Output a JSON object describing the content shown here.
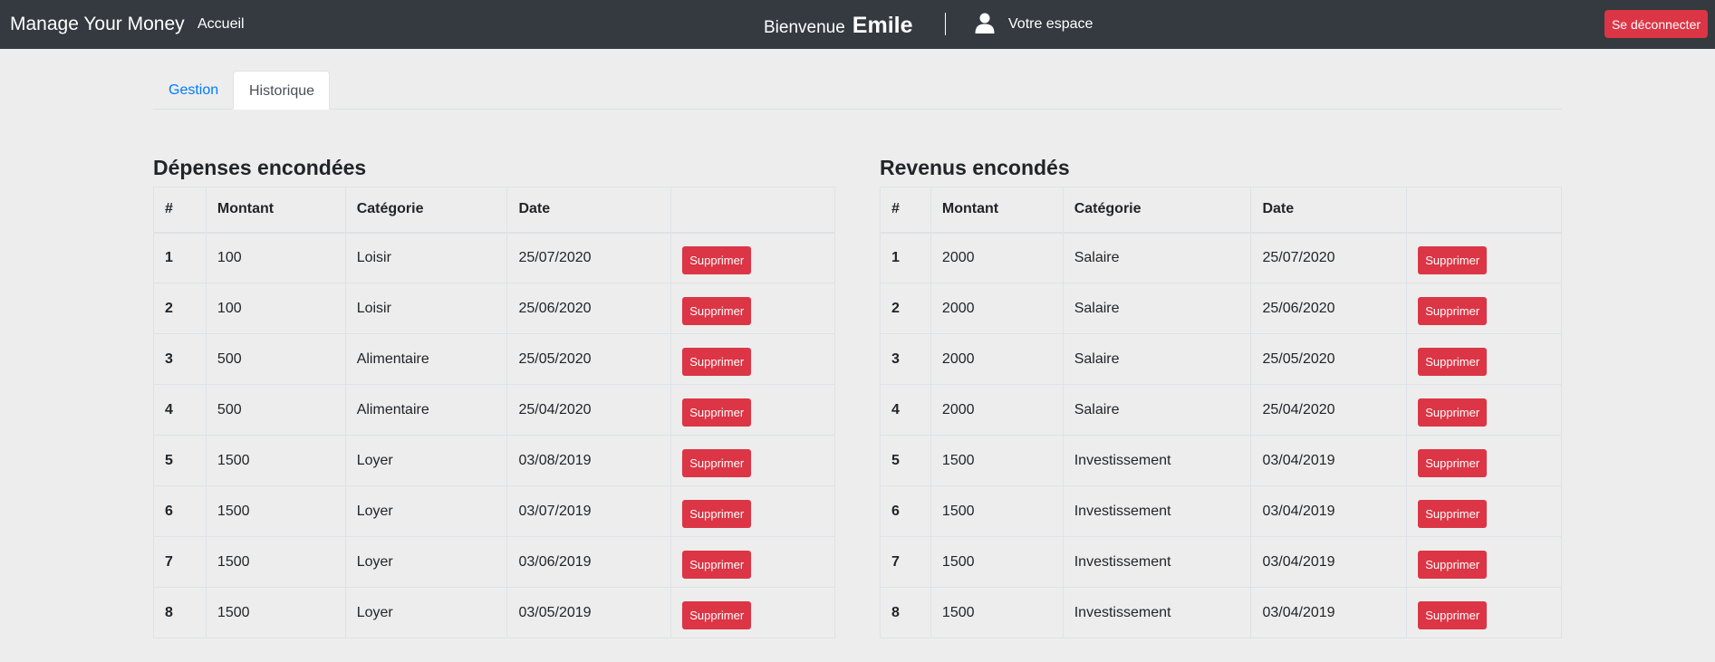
{
  "navbar": {
    "brand": "Manage Your Money",
    "home_link": "Accueil",
    "welcome_text": "Bienvenue",
    "user_name": "Emile",
    "space_link": "Votre espace",
    "logout_label": "Se déconnecter"
  },
  "tabs": [
    {
      "label": "Gestion",
      "active": false
    },
    {
      "label": "Historique",
      "active": true
    }
  ],
  "expenses": {
    "title": "Dépenses encondées",
    "headers": [
      "#",
      "Montant",
      "Catégorie",
      "Date",
      ""
    ],
    "rows": [
      {
        "id": "1",
        "amount": "100",
        "category": "Loisir",
        "date": "25/07/2020"
      },
      {
        "id": "2",
        "amount": "100",
        "category": "Loisir",
        "date": "25/06/2020"
      },
      {
        "id": "3",
        "amount": "500",
        "category": "Alimentaire",
        "date": "25/05/2020"
      },
      {
        "id": "4",
        "amount": "500",
        "category": "Alimentaire",
        "date": "25/04/2020"
      },
      {
        "id": "5",
        "amount": "1500",
        "category": "Loyer",
        "date": "03/08/2019"
      },
      {
        "id": "6",
        "amount": "1500",
        "category": "Loyer",
        "date": "03/07/2019"
      },
      {
        "id": "7",
        "amount": "1500",
        "category": "Loyer",
        "date": "03/06/2019"
      },
      {
        "id": "8",
        "amount": "1500",
        "category": "Loyer",
        "date": "03/05/2019"
      }
    ]
  },
  "incomes": {
    "title": "Revenus encondés",
    "headers": [
      "#",
      "Montant",
      "Catégorie",
      "Date",
      ""
    ],
    "rows": [
      {
        "id": "1",
        "amount": "2000",
        "category": "Salaire",
        "date": "25/07/2020"
      },
      {
        "id": "2",
        "amount": "2000",
        "category": "Salaire",
        "date": "25/06/2020"
      },
      {
        "id": "3",
        "amount": "2000",
        "category": "Salaire",
        "date": "25/05/2020"
      },
      {
        "id": "4",
        "amount": "2000",
        "category": "Salaire",
        "date": "25/04/2020"
      },
      {
        "id": "5",
        "amount": "1500",
        "category": "Investissement",
        "date": "03/04/2019"
      },
      {
        "id": "6",
        "amount": "1500",
        "category": "Investissement",
        "date": "03/04/2019"
      },
      {
        "id": "7",
        "amount": "1500",
        "category": "Investissement",
        "date": "03/04/2019"
      },
      {
        "id": "8",
        "amount": "1500",
        "category": "Investissement",
        "date": "03/04/2019"
      }
    ]
  },
  "delete_label": "Supprimer",
  "colors": {
    "navbar_bg": "#343a40",
    "danger": "#dc3545",
    "link": "#007bff",
    "page_bg": "#ededed"
  },
  "icons": {
    "user": "user-icon"
  }
}
